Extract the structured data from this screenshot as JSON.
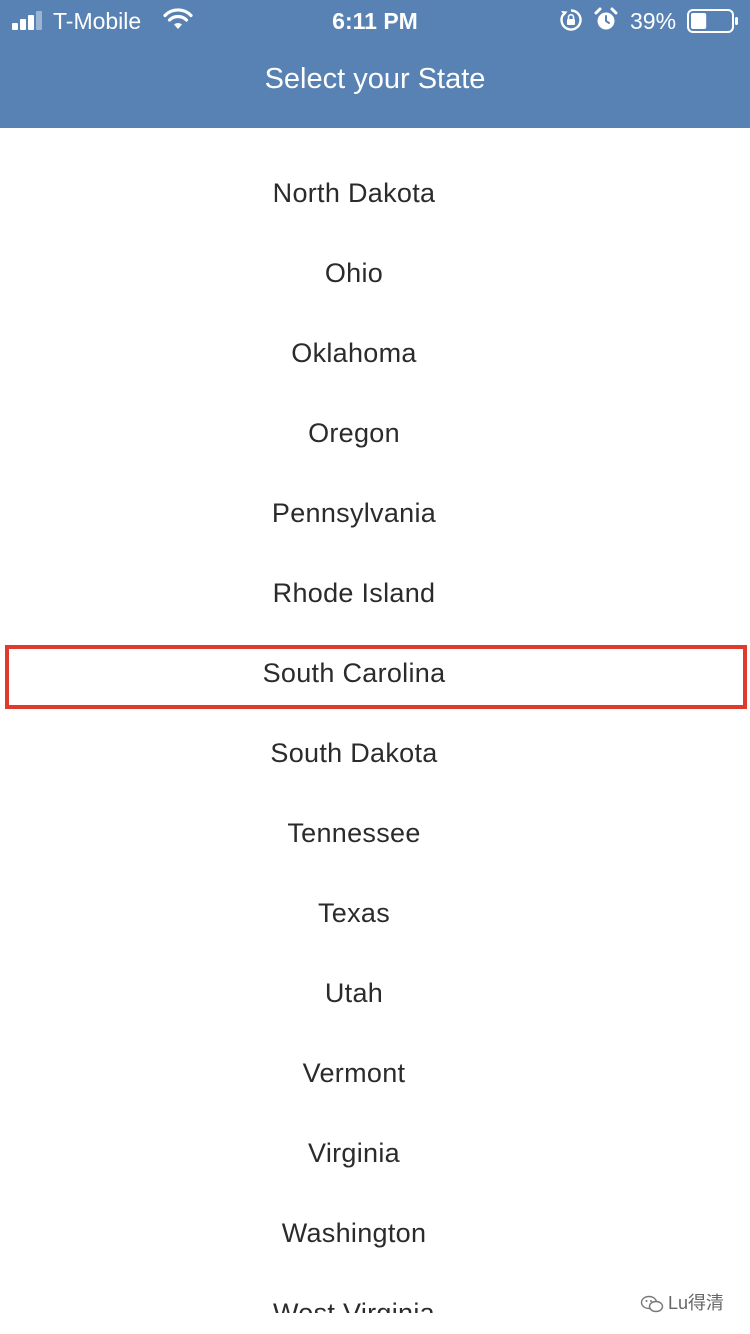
{
  "status_bar": {
    "carrier": "T-Mobile",
    "time": "6:11 PM",
    "battery_percent": "39%",
    "signal_icon": "signal-bars-icon",
    "wifi_icon": "wifi-icon",
    "rotation_lock_icon": "rotation-lock-icon",
    "alarm_icon": "alarm-clock-icon",
    "battery_icon": "battery-icon",
    "battery_level": 0.39
  },
  "header": {
    "title": "Select your State",
    "background": "#5882b3"
  },
  "state_list": {
    "items": [
      "North Dakota",
      "Ohio",
      "Oklahoma",
      "Oregon",
      "Pennsylvania",
      "Rhode Island",
      "South Carolina",
      "South Dakota",
      "Tennessee",
      "Texas",
      "Utah",
      "Vermont",
      "Virginia",
      "Washington",
      "West Virginia"
    ],
    "highlighted": "South Carolina",
    "highlight_color": "#de3b2e"
  },
  "watermark": {
    "text": "Lu得清"
  }
}
